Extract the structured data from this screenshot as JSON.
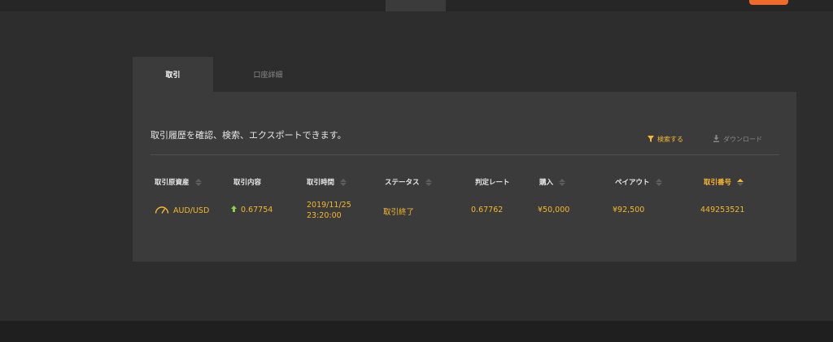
{
  "tabs": {
    "trade": "取引",
    "account": "口座詳細"
  },
  "panel": {
    "description": "取引履歴を確認、検索、エクスポートできます。",
    "search_label": "検索する",
    "download_label": "ダウンロード"
  },
  "table": {
    "headers": [
      "取引原資産",
      "取引内容",
      "取引時間",
      "ステータス",
      "判定レート",
      "購入",
      "ペイアウト",
      "取引番号"
    ],
    "rows": [
      {
        "asset": "AUD/USD",
        "trade_rate": "0.67754",
        "time_date": "2019/11/25",
        "time_clock": "23:20:00",
        "status": "取引終了",
        "judgment_rate": "0.67762",
        "purchase": "¥50,000",
        "payout": "¥92,500",
        "trade_id": "449253521"
      }
    ]
  },
  "colors": {
    "accent": "#f5b82e",
    "up_arrow": "#8bd449",
    "login_button": "#f06a2c"
  },
  "icons": {
    "asset": "gauge-icon",
    "direction": "up-arrow-icon",
    "search": "filter-icon",
    "download": "download-icon"
  }
}
